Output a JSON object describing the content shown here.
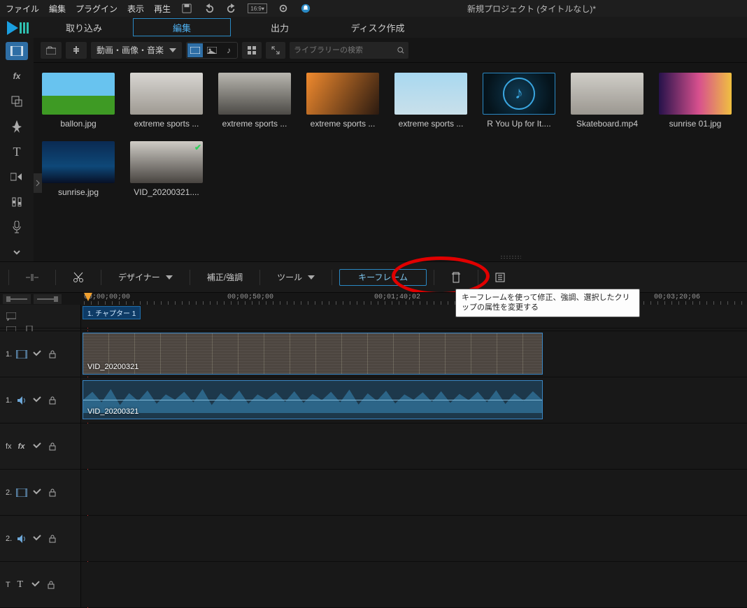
{
  "menu": {
    "items": [
      "ファイル",
      "編集",
      "プラグイン",
      "表示",
      "再生"
    ],
    "title": "新規プロジェクト (タイトルなし)*"
  },
  "modules": {
    "tabs": [
      "取り込み",
      "編集",
      "出力",
      "ディスク作成"
    ],
    "active": 1
  },
  "library": {
    "filter_label": "動画・画像・音楽",
    "search_placeholder": "ライブラリーの検索",
    "items": [
      {
        "label": "ballon.jpg",
        "kind": "image",
        "bg": "linear-gradient(#68c3ef 0%,#68c3ef 55%,#3e9a24 55%,#3e9a24 100%)"
      },
      {
        "label": "extreme sports ...",
        "kind": "image",
        "bg": "linear-gradient(#d8d6d2,#9e9a92)"
      },
      {
        "label": "extreme sports ...",
        "kind": "image",
        "bg": "linear-gradient(#b9b7b0,#4c4a46)"
      },
      {
        "label": "extreme sports ...",
        "kind": "image",
        "bg": "linear-gradient(120deg,#f08a2e,#2b1a10)"
      },
      {
        "label": "extreme sports ...",
        "kind": "image",
        "bg": "linear-gradient(#a8d8f0,#c9e0ea)"
      },
      {
        "label": "R You Up for It....",
        "kind": "audio"
      },
      {
        "label": "Skateboard.mp4",
        "kind": "video",
        "bg": "linear-gradient(#d0cec8,#9b9790)"
      },
      {
        "label": "sunrise 01.jpg",
        "kind": "image",
        "bg": "linear-gradient(90deg,#26124a,#d7508e 55%,#f0c040)"
      },
      {
        "label": "sunrise.jpg",
        "kind": "image",
        "bg": "linear-gradient(#0a2a52,#0e4878 60%,#071026)"
      },
      {
        "label": "VID_20200321....",
        "kind": "video",
        "bg": "linear-gradient(#cfccc6,#484440)",
        "checked": true
      }
    ]
  },
  "tl_toolbar": {
    "designer": "デザイナー",
    "fix": "補正/強調",
    "tool": "ツール",
    "keyframe": "キーフレーム",
    "tooltip": "キーフレームを使って修正、強調、選択したクリップの属性を変更する"
  },
  "ruler": {
    "labels": [
      "00;00;00;00",
      "00;00;50;00",
      "00;01;40;02",
      "00;03;20;06"
    ]
  },
  "chapter_label": "1. チャプター 1",
  "tracks": [
    {
      "head": "1.",
      "type": "video",
      "icon": "film",
      "clip_label": "VID_20200321"
    },
    {
      "head": "1.",
      "type": "audio",
      "icon": "speaker",
      "clip_label": "VID_20200321"
    },
    {
      "head": "fx",
      "type": "fx",
      "icon": "fx"
    },
    {
      "head": "2.",
      "type": "video",
      "icon": "film"
    },
    {
      "head": "2.",
      "type": "audio",
      "icon": "speaker"
    },
    {
      "head": "T",
      "type": "title",
      "icon": "text"
    }
  ]
}
